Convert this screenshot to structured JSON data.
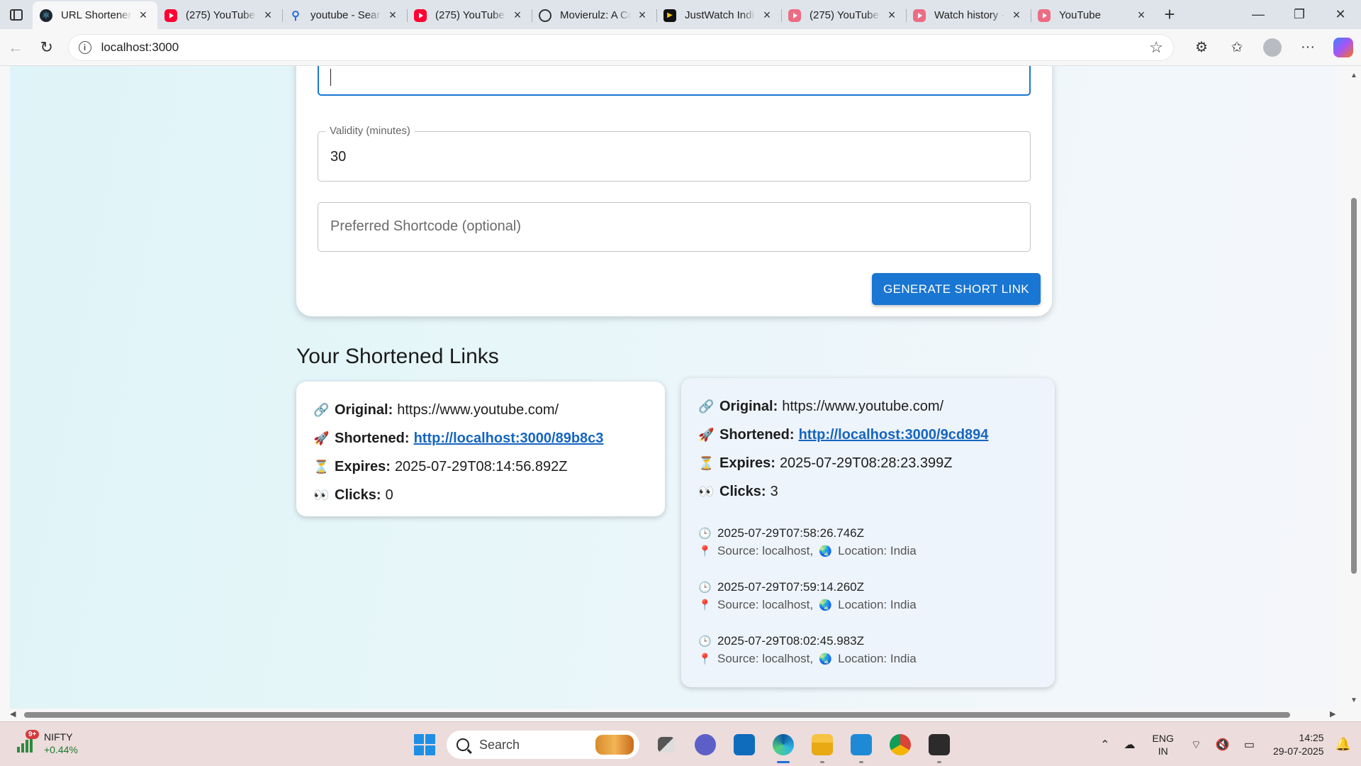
{
  "browser": {
    "tabs": [
      {
        "label": "URL Shortener",
        "icon": "react-icon",
        "active": true
      },
      {
        "label": "(275) YouTube",
        "icon": "youtube-icon"
      },
      {
        "label": "youtube - Sear",
        "icon": "search-icon"
      },
      {
        "label": "(275) YouTube",
        "icon": "youtube-icon"
      },
      {
        "label": "Movierulz: A Co",
        "icon": "globe-icon"
      },
      {
        "label": "JustWatch Indi",
        "icon": "justwatch-icon"
      },
      {
        "label": "(275) YouTube",
        "icon": "youtube-icon"
      },
      {
        "label": "Watch history -",
        "icon": "youtube-icon"
      },
      {
        "label": "YouTube",
        "icon": "youtube-icon"
      }
    ],
    "address": "localhost:3000"
  },
  "form": {
    "validity_label": "Validity (minutes)",
    "validity_value": "30",
    "shortcode_placeholder": "Preferred Shortcode (optional)",
    "generate_label": "GENERATE SHORT LINK"
  },
  "links_section": {
    "title": "Your Shortened Links",
    "labels": {
      "original": "Original:",
      "shortened": "Shortened:",
      "expires": "Expires:",
      "clicks": "Clicks:"
    },
    "cards": [
      {
        "original": "https://www.youtube.com/",
        "shortened": "http://localhost:3000/89b8c3",
        "expires": "2025-07-29T08:14:56.892Z",
        "clicks": "0",
        "visits": []
      },
      {
        "original": "https://www.youtube.com/",
        "shortened": "http://localhost:3000/9cd894",
        "expires": "2025-07-29T08:28:23.399Z",
        "clicks": "3",
        "visits": [
          {
            "time": "2025-07-29T07:58:26.746Z",
            "source": "Source: localhost,",
            "location": "Location: India"
          },
          {
            "time": "2025-07-29T07:59:14.260Z",
            "source": "Source: localhost,",
            "location": "Location: India"
          },
          {
            "time": "2025-07-29T08:02:45.983Z",
            "source": "Source: localhost,",
            "location": "Location: India"
          }
        ]
      }
    ]
  },
  "taskbar": {
    "ticker_name": "NIFTY",
    "ticker_change": "+0.44%",
    "ticker_badge": "9+",
    "search_label": "Search",
    "lang_top": "ENG",
    "lang_bottom": "IN",
    "time": "14:25",
    "date": "29-07-2025"
  },
  "colors": {
    "primary": "#1976d2",
    "link": "#1565c0",
    "page_bg": "#e7f6f9"
  }
}
